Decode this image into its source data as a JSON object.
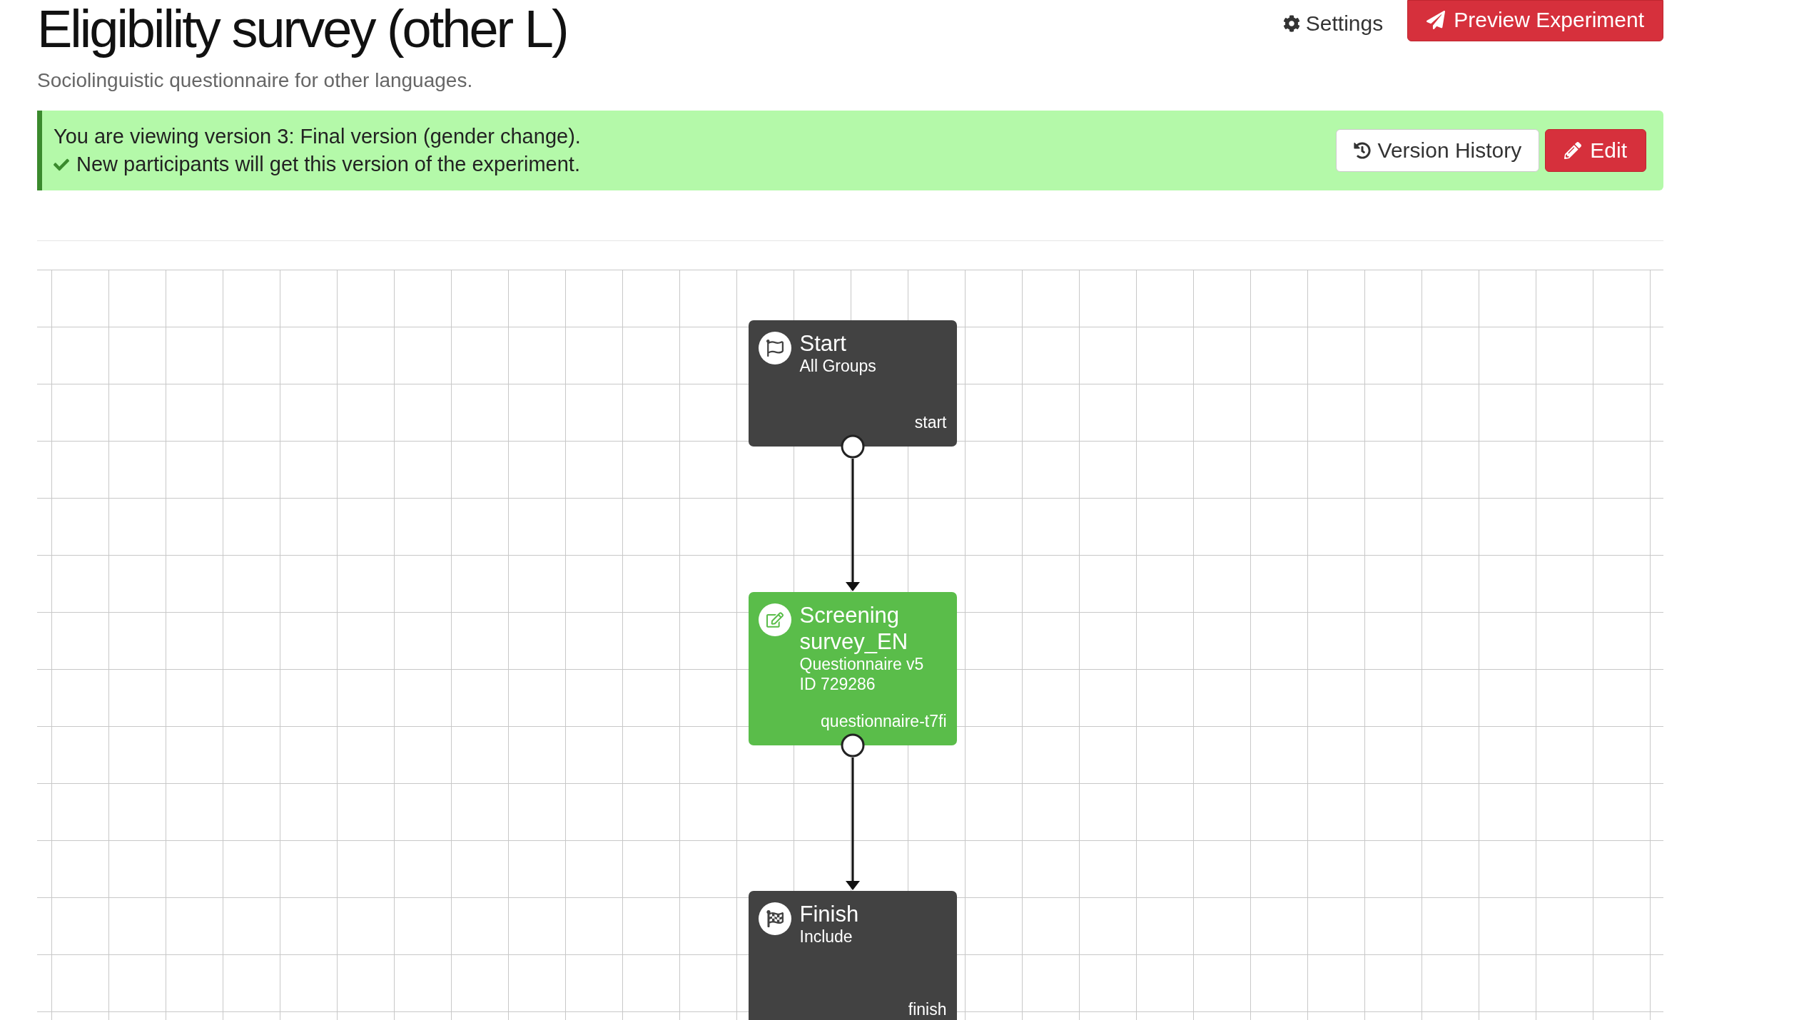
{
  "header": {
    "title": "Eligibility survey (other L)",
    "subtitle": "Sociolinguistic questionnaire for other languages.",
    "actions": [
      {
        "kind": "link",
        "label": "Settings"
      },
      {
        "kind": "primary",
        "label": "Preview Experiment"
      }
    ]
  },
  "banner": {
    "line_1": "You are viewing version 3: Final version (gender change).",
    "line_2": "New participants will get this version of the experiment.",
    "buttons": [
      {
        "kind": "history",
        "label": "Version History"
      },
      {
        "kind": "edit",
        "label": "Edit"
      }
    ]
  },
  "flow": {
    "nodes": [
      {
        "kind": "start",
        "title": "Start",
        "details": [
          "All Groups"
        ],
        "tag": "start"
      },
      {
        "kind": "questionnaire",
        "title": "Screening survey_EN",
        "details": [
          "Questionnaire v5",
          "ID 729286"
        ],
        "tag": "questionnaire-t7fi"
      },
      {
        "kind": "finish",
        "title": "Finish",
        "details": [
          "Include"
        ],
        "tag": "finish"
      }
    ]
  }
}
